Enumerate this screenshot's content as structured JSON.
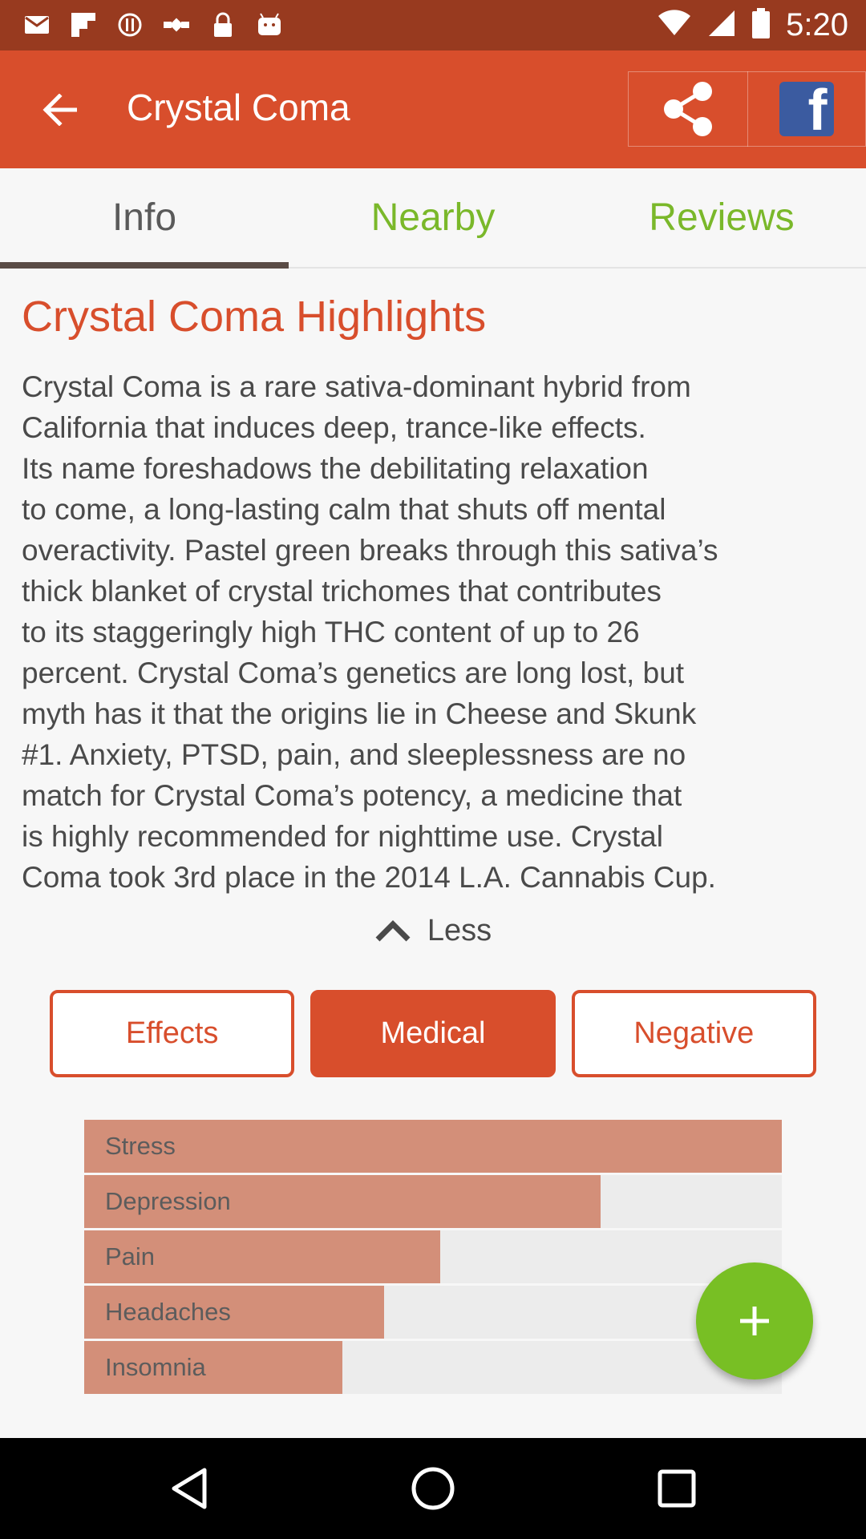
{
  "status_bar": {
    "time": "5:20",
    "icons": [
      "mail-icon",
      "flipboard-icon",
      "alert-circle-icon",
      "fake-gps-icon",
      "lock-icon",
      "android-icon",
      "wifi-icon",
      "signal-icon",
      "battery-icon"
    ]
  },
  "app_bar": {
    "title": "Crystal Coma",
    "back_icon": "arrow-back-icon",
    "share_icon": "share-icon",
    "facebook_icon": "facebook-icon"
  },
  "tabs": [
    {
      "label": "Info",
      "active": true
    },
    {
      "label": "Nearby",
      "active": false
    },
    {
      "label": "Reviews",
      "active": false
    }
  ],
  "highlights": {
    "heading": "Crystal Coma Highlights",
    "lines": [
      "Crystal Coma is a rare sativa-dominant hybrid from",
      "California that induces deep, trance-like effects.",
      "Its name foreshadows the debilitating relaxation",
      "to come, a long-lasting calm that shuts off mental",
      "overactivity. Pastel green breaks through this sativa’s",
      "thick blanket of crystal trichomes that contributes",
      "to its staggeringly high THC content of up to 26",
      "percent. Crystal Coma’s genetics are long lost, but",
      "myth has it that the origins lie in Cheese and Skunk",
      "#1. Anxiety, PTSD, pain, and sleeplessness are no",
      "match for Crystal Coma’s potency, a medicine that",
      "is highly recommended for nighttime use. Crystal",
      "Coma took 3rd place in the 2014 L.A. Cannabis Cup."
    ],
    "toggle_label": "Less"
  },
  "segments": [
    {
      "label": "Effects",
      "selected": false
    },
    {
      "label": "Medical",
      "selected": true
    },
    {
      "label": "Negative",
      "selected": false
    }
  ],
  "medical_bars": [
    {
      "label": "Stress",
      "level": 1.0
    },
    {
      "label": "Depression",
      "level": 0.74
    },
    {
      "label": "Pain",
      "level": 0.51
    },
    {
      "label": "Headaches",
      "level": 0.43
    },
    {
      "label": "Insomnia",
      "level": 0.37
    }
  ],
  "fab": {
    "icon": "plus-icon"
  },
  "nav_bar": {
    "icons": [
      "back-triangle-icon",
      "home-circle-icon",
      "recents-square-icon"
    ]
  },
  "colors": {
    "status_bar": "#983a1f",
    "accent": "#d84e2c",
    "bar_fill": "#d38f79",
    "tab_inactive": "#7ab82a",
    "fab": "#78bf24",
    "facebook": "#3b5ba0"
  }
}
